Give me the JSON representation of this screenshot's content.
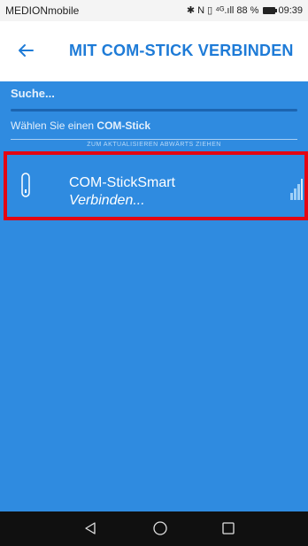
{
  "status_bar": {
    "carrier": "MEDIONmobile",
    "indicators": "✱ N ▯ ⁴ᴳ.ıll",
    "battery_percent": "88 %",
    "time": "09:39"
  },
  "app_bar": {
    "back_icon": "arrow-left-icon",
    "title": "MIT COM-STICK VERBINDEN"
  },
  "search": {
    "label": "Suche...",
    "select_prefix": "Wählen Sie einen ",
    "select_bold": "COM-Stick",
    "pull_hint": "ZUM AKTUALISIEREN ABWÄRTS ZIEHEN"
  },
  "device": {
    "name": "COM-StickSmart",
    "status": "Verbinden...",
    "icon": "usb-stick-icon",
    "signal_icon": "signal-bars-icon"
  },
  "colors": {
    "accent": "#1e7bd7",
    "content_bg": "#2f8be0",
    "highlight": "#e30613"
  },
  "nav_bar": {
    "back_icon": "nav-back-icon",
    "home_icon": "nav-home-icon",
    "recent_icon": "nav-recent-icon"
  }
}
